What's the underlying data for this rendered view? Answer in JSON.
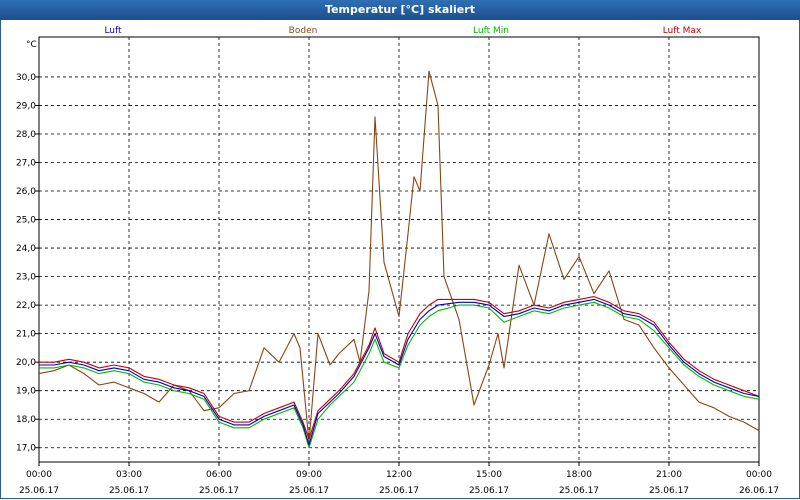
{
  "window": {
    "title": "Temperatur [°C] skaliert"
  },
  "chart_data": {
    "type": "line",
    "title": "Temperatur [°C] skaliert",
    "ylabel": "°C",
    "ylim": [
      16.5,
      31.4
    ],
    "xlim": [
      "25.06.17 00:00",
      "26.06.17 00:00"
    ],
    "yticks": [
      "17,0",
      "18,0",
      "19,0",
      "20,0",
      "21,0",
      "22,0",
      "23,0",
      "24,0",
      "25,0",
      "26,0",
      "27,0",
      "28,0",
      "29,0",
      "30,0"
    ],
    "xticks": [
      {
        "time": "00:00",
        "date": "25.06.17"
      },
      {
        "time": "03:00",
        "date": "25.06.17"
      },
      {
        "time": "06:00",
        "date": "25.06.17"
      },
      {
        "time": "09:00",
        "date": "25.06.17"
      },
      {
        "time": "12:00",
        "date": "25.06.17"
      },
      {
        "time": "15:00",
        "date": "25.06.17"
      },
      {
        "time": "18:00",
        "date": "25.06.17"
      },
      {
        "time": "21:00",
        "date": "25.06.17"
      },
      {
        "time": "00:00",
        "date": "26.06.17"
      }
    ],
    "grid": true,
    "legend_position": "top",
    "x_unit": "hours after 25.06.17 00:00",
    "series": [
      {
        "name": "Luft",
        "color": "#0000cc",
        "points": [
          [
            0,
            19.9
          ],
          [
            0.5,
            19.9
          ],
          [
            1,
            20.0
          ],
          [
            1.5,
            19.9
          ],
          [
            2,
            19.7
          ],
          [
            2.5,
            19.8
          ],
          [
            3,
            19.7
          ],
          [
            3.5,
            19.4
          ],
          [
            4,
            19.3
          ],
          [
            4.5,
            19.1
          ],
          [
            5,
            19.0
          ],
          [
            5.5,
            18.8
          ],
          [
            6,
            18.0
          ],
          [
            6.5,
            17.8
          ],
          [
            7,
            17.8
          ],
          [
            7.5,
            18.1
          ],
          [
            8,
            18.3
          ],
          [
            8.5,
            18.5
          ],
          [
            8.8,
            17.8
          ],
          [
            9,
            17.1
          ],
          [
            9.3,
            18.2
          ],
          [
            9.7,
            18.6
          ],
          [
            10,
            18.9
          ],
          [
            10.5,
            19.5
          ],
          [
            11,
            20.5
          ],
          [
            11.2,
            21.0
          ],
          [
            11.5,
            20.2
          ],
          [
            12,
            19.9
          ],
          [
            12.3,
            20.8
          ],
          [
            12.7,
            21.5
          ],
          [
            13,
            21.8
          ],
          [
            13.3,
            22.0
          ],
          [
            14,
            22.1
          ],
          [
            14.5,
            22.1
          ],
          [
            15,
            22.0
          ],
          [
            15.5,
            21.6
          ],
          [
            16,
            21.7
          ],
          [
            16.5,
            21.9
          ],
          [
            17,
            21.8
          ],
          [
            17.5,
            22.0
          ],
          [
            18,
            22.1
          ],
          [
            18.5,
            22.2
          ],
          [
            19,
            22.0
          ],
          [
            19.5,
            21.7
          ],
          [
            20,
            21.6
          ],
          [
            20.5,
            21.3
          ],
          [
            21,
            20.6
          ],
          [
            21.5,
            20.0
          ],
          [
            22,
            19.6
          ],
          [
            22.5,
            19.3
          ],
          [
            23,
            19.1
          ],
          [
            23.5,
            18.9
          ],
          [
            24,
            18.8
          ]
        ]
      },
      {
        "name": "Boden",
        "color": "#8b4513",
        "points": [
          [
            0,
            19.6
          ],
          [
            0.5,
            19.7
          ],
          [
            1,
            19.9
          ],
          [
            1.5,
            19.6
          ],
          [
            2,
            19.2
          ],
          [
            2.5,
            19.3
          ],
          [
            3,
            19.1
          ],
          [
            3.5,
            18.9
          ],
          [
            4,
            18.6
          ],
          [
            4.5,
            19.2
          ],
          [
            5,
            19.0
          ],
          [
            5.5,
            18.3
          ],
          [
            6,
            18.4
          ],
          [
            6.5,
            18.9
          ],
          [
            7,
            19.0
          ],
          [
            7.5,
            20.5
          ],
          [
            8,
            20.0
          ],
          [
            8.5,
            21.0
          ],
          [
            8.7,
            20.5
          ],
          [
            9,
            17.2
          ],
          [
            9.3,
            21.0
          ],
          [
            9.7,
            19.9
          ],
          [
            10,
            20.3
          ],
          [
            10.5,
            20.8
          ],
          [
            10.7,
            20.0
          ],
          [
            11,
            22.5
          ],
          [
            11.2,
            28.6
          ],
          [
            11.5,
            23.5
          ],
          [
            12,
            21.6
          ],
          [
            12.3,
            24.5
          ],
          [
            12.5,
            26.5
          ],
          [
            12.7,
            26.0
          ],
          [
            13,
            30.2
          ],
          [
            13.3,
            29.0
          ],
          [
            13.5,
            23.0
          ],
          [
            14,
            21.5
          ],
          [
            14.5,
            18.5
          ],
          [
            15,
            19.9
          ],
          [
            15.3,
            21.0
          ],
          [
            15.5,
            19.8
          ],
          [
            16,
            23.4
          ],
          [
            16.5,
            22.0
          ],
          [
            17,
            24.5
          ],
          [
            17.5,
            22.9
          ],
          [
            18,
            23.7
          ],
          [
            18.5,
            22.4
          ],
          [
            19,
            23.2
          ],
          [
            19.5,
            21.5
          ],
          [
            20,
            21.3
          ],
          [
            20.5,
            20.5
          ],
          [
            21,
            19.8
          ],
          [
            21.5,
            19.2
          ],
          [
            22,
            18.6
          ],
          [
            22.5,
            18.4
          ],
          [
            23,
            18.1
          ],
          [
            23.5,
            17.9
          ],
          [
            24,
            17.6
          ]
        ]
      },
      {
        "name": "Luft Min",
        "color": "#00bb00",
        "points": [
          [
            0,
            19.8
          ],
          [
            0.5,
            19.8
          ],
          [
            1,
            19.9
          ],
          [
            1.5,
            19.8
          ],
          [
            2,
            19.6
          ],
          [
            2.5,
            19.7
          ],
          [
            3,
            19.6
          ],
          [
            3.5,
            19.3
          ],
          [
            4,
            19.2
          ],
          [
            4.5,
            19.0
          ],
          [
            5,
            18.9
          ],
          [
            5.5,
            18.7
          ],
          [
            6,
            17.9
          ],
          [
            6.5,
            17.7
          ],
          [
            7,
            17.7
          ],
          [
            7.5,
            18.0
          ],
          [
            8,
            18.2
          ],
          [
            8.5,
            18.4
          ],
          [
            8.8,
            17.7
          ],
          [
            9,
            17.0
          ],
          [
            9.3,
            18.0
          ],
          [
            9.7,
            18.5
          ],
          [
            10,
            18.8
          ],
          [
            10.5,
            19.3
          ],
          [
            11,
            20.3
          ],
          [
            11.2,
            20.8
          ],
          [
            11.5,
            20.0
          ],
          [
            12,
            19.8
          ],
          [
            12.3,
            20.6
          ],
          [
            12.7,
            21.3
          ],
          [
            13,
            21.6
          ],
          [
            13.3,
            21.8
          ],
          [
            14,
            22.0
          ],
          [
            14.5,
            22.0
          ],
          [
            15,
            21.9
          ],
          [
            15.5,
            21.4
          ],
          [
            16,
            21.6
          ],
          [
            16.5,
            21.8
          ],
          [
            17,
            21.7
          ],
          [
            17.5,
            21.9
          ],
          [
            18,
            22.0
          ],
          [
            18.5,
            22.1
          ],
          [
            19,
            21.9
          ],
          [
            19.5,
            21.6
          ],
          [
            20,
            21.5
          ],
          [
            20.5,
            21.1
          ],
          [
            21,
            20.5
          ],
          [
            21.5,
            19.9
          ],
          [
            22,
            19.5
          ],
          [
            22.5,
            19.2
          ],
          [
            23,
            19.0
          ],
          [
            23.5,
            18.8
          ],
          [
            24,
            18.7
          ]
        ]
      },
      {
        "name": "Luft Max",
        "color": "#cc0000",
        "points": [
          [
            0,
            20.0
          ],
          [
            0.5,
            20.0
          ],
          [
            1,
            20.1
          ],
          [
            1.5,
            20.0
          ],
          [
            2,
            19.8
          ],
          [
            2.5,
            19.9
          ],
          [
            3,
            19.8
          ],
          [
            3.5,
            19.5
          ],
          [
            4,
            19.4
          ],
          [
            4.5,
            19.2
          ],
          [
            5,
            19.1
          ],
          [
            5.5,
            18.9
          ],
          [
            6,
            18.1
          ],
          [
            6.5,
            17.9
          ],
          [
            7,
            17.9
          ],
          [
            7.5,
            18.2
          ],
          [
            8,
            18.4
          ],
          [
            8.5,
            18.6
          ],
          [
            8.8,
            17.9
          ],
          [
            9,
            17.3
          ],
          [
            9.3,
            18.3
          ],
          [
            9.7,
            18.7
          ],
          [
            10,
            19.0
          ],
          [
            10.5,
            19.6
          ],
          [
            11,
            20.6
          ],
          [
            11.2,
            21.2
          ],
          [
            11.5,
            20.3
          ],
          [
            12,
            20.0
          ],
          [
            12.3,
            21.0
          ],
          [
            12.7,
            21.7
          ],
          [
            13,
            22.0
          ],
          [
            13.3,
            22.2
          ],
          [
            14,
            22.2
          ],
          [
            14.5,
            22.2
          ],
          [
            15,
            22.1
          ],
          [
            15.5,
            21.7
          ],
          [
            16,
            21.8
          ],
          [
            16.5,
            22.0
          ],
          [
            17,
            21.9
          ],
          [
            17.5,
            22.1
          ],
          [
            18,
            22.2
          ],
          [
            18.5,
            22.3
          ],
          [
            19,
            22.1
          ],
          [
            19.5,
            21.8
          ],
          [
            20,
            21.7
          ],
          [
            20.5,
            21.4
          ],
          [
            21,
            20.7
          ],
          [
            21.5,
            20.1
          ],
          [
            22,
            19.7
          ],
          [
            22.5,
            19.4
          ],
          [
            23,
            19.2
          ],
          [
            23.5,
            19.0
          ],
          [
            24,
            18.8
          ]
        ]
      }
    ]
  }
}
